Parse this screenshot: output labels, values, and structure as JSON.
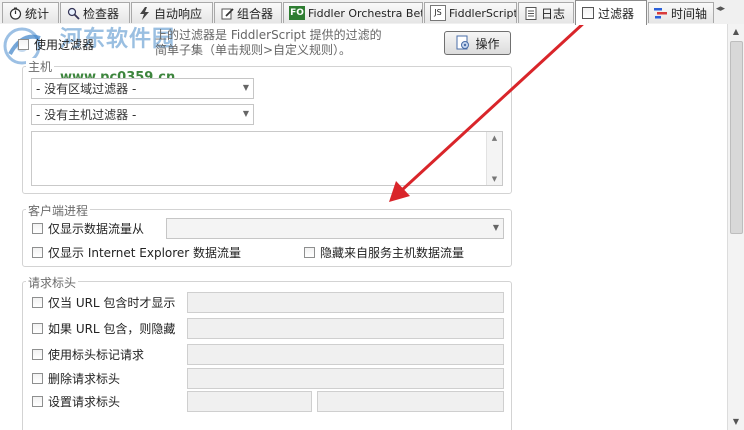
{
  "tabs": [
    {
      "label": "统计",
      "icon": "stopwatch-icon"
    },
    {
      "label": "检查器",
      "icon": "magnifier-icon"
    },
    {
      "label": "自动响应",
      "icon": "lightning-icon"
    },
    {
      "label": "组合器",
      "icon": "edit-icon"
    },
    {
      "label": "Fiddler Orchestra Beta",
      "icon": "fo-icon",
      "icon_text": "FO"
    },
    {
      "label": "FiddlerScript",
      "icon": "script-icon",
      "icon_text": "JS"
    },
    {
      "label": "日志",
      "icon": "log-icon"
    },
    {
      "label": "过滤器",
      "icon": "filter-checkbox-icon"
    },
    {
      "label": "时间轴",
      "icon": "timeline-icon"
    }
  ],
  "watermark": {
    "text": "河东软件园",
    "url": "www.pc0359.cn"
  },
  "top": {
    "use_filters_label": "使用过滤器",
    "description_line1": "上的过滤器是 FiddlerScript 提供的过滤的",
    "description_line2": "简单子集（单击规则>自定义规则）。",
    "actions_label": "操作"
  },
  "hosts": {
    "legend": "主机",
    "zone_filter": "- 没有区域过滤器 -",
    "host_filter": "- 没有主机过滤器 -"
  },
  "client": {
    "legend": "客户端进程",
    "only_from_label": "仅显示数据流量从",
    "ie_only_label": "仅显示 Internet Explorer 数据流量",
    "hide_service_label": "隐藏来自服务主机数据流量"
  },
  "headers": {
    "legend": "请求标头",
    "url_contains_label": "仅当 URL 包含时才显示",
    "hide_if_url_label": "如果 URL 包含，则隐藏",
    "flag_label": "使用标头标记请求",
    "delete_label": "删除请求标头",
    "set_label": "设置请求标头"
  },
  "colors": {
    "arrow": "#d9252a",
    "accent": "#2e7d32"
  }
}
